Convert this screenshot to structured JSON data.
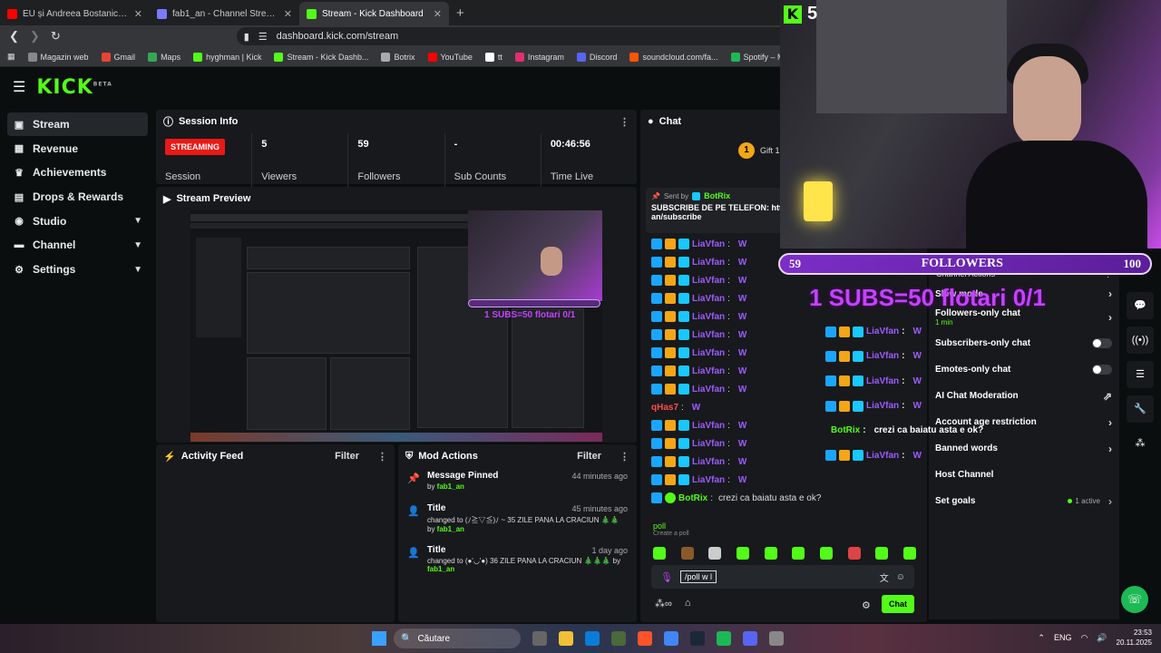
{
  "browser": {
    "tabs": [
      {
        "title": "EU și Andreea Bostanica Am Ajuns La",
        "color": "#ff0000",
        "active": false
      },
      {
        "title": "fab1_an - Channel Streams on Kick",
        "color": "#7a7aff",
        "active": false
      },
      {
        "title": "Stream - Kick Dashboard",
        "color": "#53fc18",
        "active": true
      }
    ],
    "new_tab": "+",
    "url": "dashboard.kick.com/stream",
    "bookmarks": [
      {
        "label": "Magazin web",
        "color": "#888"
      },
      {
        "label": "Gmail",
        "color": "#ea4335"
      },
      {
        "label": "Maps",
        "color": "#34a853"
      },
      {
        "label": "hyghman | Kick",
        "color": "#53fc18"
      },
      {
        "label": "Stream - Kick Dashb...",
        "color": "#53fc18"
      },
      {
        "label": "Botrix",
        "color": "#aaa"
      },
      {
        "label": "YouTube",
        "color": "#ff0000"
      },
      {
        "label": "tt",
        "color": "#fff"
      },
      {
        "label": "Instagram",
        "color": "#e1306c"
      },
      {
        "label": "Discord",
        "color": "#5865f2"
      },
      {
        "label": "soundcloud.com/fa...",
        "color": "#ff5500"
      },
      {
        "label": "Spotify – Melodii în...",
        "color": "#1db954"
      }
    ]
  },
  "sidebar": {
    "items": [
      {
        "label": "Stream",
        "icon": "▣",
        "chevron": false
      },
      {
        "label": "Revenue",
        "icon": "▦",
        "chevron": false
      },
      {
        "label": "Achievements",
        "icon": "♛",
        "chevron": false
      },
      {
        "label": "Drops & Rewards",
        "icon": "▤",
        "chevron": false
      },
      {
        "label": "Studio",
        "icon": "◉",
        "chevron": true
      },
      {
        "label": "Channel",
        "icon": "▬",
        "chevron": true
      },
      {
        "label": "Settings",
        "icon": "⚙",
        "chevron": true
      }
    ]
  },
  "session": {
    "title": "Session Info",
    "status": "STREAMING",
    "status_label": "Session",
    "viewers": "5",
    "viewers_label": "Viewers",
    "followers": "59",
    "followers_label": "Followers",
    "subs": "-",
    "subs_label": "Sub Counts",
    "time": "00:46:56",
    "time_label": "Time Live"
  },
  "preview": {
    "title": "Stream Preview",
    "overlay_subs": "1 SUBS=50 flotari 0/1",
    "overlay_followers": "FOLLOWERS"
  },
  "activity": {
    "title": "Activity Feed",
    "filter": "Filter"
  },
  "mod_actions": {
    "title": "Mod Actions",
    "filter": "Filter",
    "items": [
      {
        "title": "Message Pinned",
        "time": "44 minutes ago",
        "desc": "by ",
        "user": "fab1_an",
        "tail": ""
      },
      {
        "title": "Title",
        "time": "45 minutes ago",
        "desc": "changed to (ﾉ≧▽≦)ﾉ ~ 35 ZILE PANA LA CRACIUN 🎄🎄 by ",
        "user": "fab1_an",
        "tail": ""
      },
      {
        "title": "Title",
        "time": "1 day ago",
        "desc": "changed to (●'◡'●) 36 ZILE PANA LA CRACIUN 🎄🎄🎄 by ",
        "user": "fab1_an",
        "tail": ""
      }
    ]
  },
  "chat": {
    "title": "Chat",
    "gift_label": "Gift 1",
    "pinned_sent_by": "Sent by",
    "pinned_user": "BotRix",
    "pinned_text": "SUBSCRIBE DE PE TELEFON: htt",
    "pinned_text2": "an/subscribe",
    "messages": [
      {
        "user": "LiaVfan",
        "text": "W",
        "color": "purple"
      },
      {
        "user": "LiaVfan",
        "text": "W",
        "color": "purple"
      },
      {
        "user": "LiaVfan",
        "text": "W",
        "color": "purple"
      },
      {
        "user": "LiaVfan",
        "text": "W",
        "color": "purple"
      },
      {
        "user": "LiaVfan",
        "text": "W",
        "color": "purple"
      },
      {
        "user": "LiaVfan",
        "text": "W",
        "color": "purple"
      },
      {
        "user": "LiaVfan",
        "text": "W",
        "color": "purple"
      },
      {
        "user": "LiaVfan",
        "text": "W",
        "color": "purple"
      },
      {
        "user": "LiaVfan",
        "text": "W",
        "color": "purple"
      },
      {
        "user": "qHas7",
        "text": "W",
        "color": "red"
      },
      {
        "user": "LiaVfan",
        "text": "W",
        "color": "purple"
      },
      {
        "user": "LiaVfan",
        "text": "W",
        "color": "purple"
      },
      {
        "user": "LiaVfan",
        "text": "W",
        "color": "purple"
      },
      {
        "user": "LiaVfan",
        "text": "W",
        "color": "purple"
      },
      {
        "user": "BotRix",
        "text": "crezi ca baiatu asta e ok?",
        "color": "green"
      }
    ],
    "overlay_messages": [
      {
        "user": "LiaVfan",
        "text": "W"
      },
      {
        "user": "LiaVfan",
        "text": "W"
      },
      {
        "user": "LiaVfan",
        "text": "W"
      },
      {
        "user": "LiaVfan",
        "text": "W"
      },
      {
        "user": "BotRix",
        "text": "crezi ca baiatu asta e ok?"
      },
      {
        "user": "LiaVfan",
        "text": "W"
      }
    ],
    "command": "poll",
    "command_desc": "Create a poll",
    "input_value": "/poll w l",
    "send_label": "Chat"
  },
  "overlay": {
    "kick_count": "5",
    "followers_current": "59",
    "followers_label": "FOLLOWERS",
    "followers_goal": "100",
    "subs_goal": "1 SUBS=50 flotari 0/1"
  },
  "chat_settings": {
    "header": "Channel Actions",
    "rows": [
      {
        "label": "Slow mode",
        "type": "chevron",
        "sub": ""
      },
      {
        "label": "Followers-only chat",
        "type": "chevron",
        "sub": "1 min"
      },
      {
        "label": "Subscribers-only chat",
        "type": "toggle",
        "sub": ""
      },
      {
        "label": "Emotes-only chat",
        "type": "toggle",
        "sub": ""
      },
      {
        "label": "AI Chat Moderation",
        "type": "external",
        "sub": ""
      },
      {
        "label": "Account age restriction",
        "type": "chevron",
        "sub": ""
      },
      {
        "label": "Banned words",
        "type": "chevron",
        "sub": ""
      },
      {
        "label": "Host Channel",
        "type": "none",
        "sub": ""
      },
      {
        "label": "Set goals",
        "type": "active",
        "sub": "1 active"
      }
    ]
  },
  "taskbar": {
    "search": "Căutare",
    "lang": "ENG",
    "time": "23:53",
    "date": "20.11.2025"
  }
}
